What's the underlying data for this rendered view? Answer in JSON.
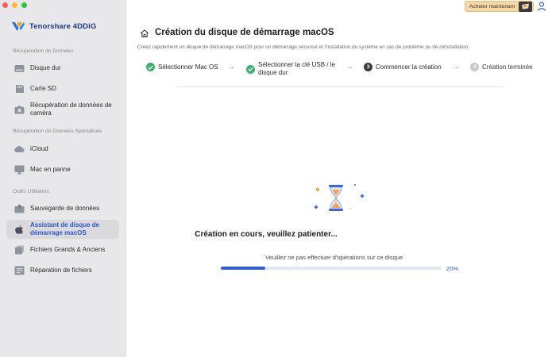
{
  "app": {
    "name": "Tenorshare 4DDiG"
  },
  "colors": {
    "accent": "#2f5bd8",
    "success": "#3ab26d",
    "sidebar_bg": "#e8e8ea",
    "buy_button": "#f6d9a6"
  },
  "header": {
    "buy_label": "Acheter maintenant",
    "buy_icon": "cart-icon",
    "user_icon": "user-icon"
  },
  "sidebar": {
    "sections": [
      {
        "title": "Récupération de Données",
        "items": [
          {
            "label": "Disque dur",
            "icon": "hard-drive-icon"
          },
          {
            "label": "Carte SD",
            "icon": "sd-card-icon"
          },
          {
            "label": "Récupération de données de caméra",
            "icon": "camera-icon"
          }
        ]
      },
      {
        "title": "Récupération de Données Spécialisée",
        "items": [
          {
            "label": "iCloud",
            "icon": "cloud-icon"
          },
          {
            "label": "Mac en panne",
            "icon": "mac-icon"
          }
        ]
      },
      {
        "title": "Outils Utilitaires",
        "items": [
          {
            "label": "Sauvegarde de données",
            "icon": "backup-icon"
          },
          {
            "label": "Assistant de disque de démarrage macOS",
            "icon": "apple-icon",
            "active": true
          },
          {
            "label": "Fichiers Grands & Anciens",
            "icon": "files-icon"
          },
          {
            "label": "Réparation de fichiers",
            "icon": "file-repair-icon"
          }
        ]
      }
    ]
  },
  "main": {
    "title": "Création du disque de démarrage macOS",
    "subtitle": "Créez rapidement un disque de démarrage macOS pour un démarrage sécurisé et l'installation du système en cas de problème ou de réinstallation.",
    "steps": [
      {
        "number": "1",
        "label": "Sélectionner Mac OS",
        "state": "done"
      },
      {
        "number": "2",
        "label": "Sélectionner la clé USB / le disque dur",
        "state": "done"
      },
      {
        "number": "3",
        "label": "Commencer la création",
        "state": "current"
      },
      {
        "number": "4",
        "label": "Création terminée",
        "state": "todo"
      }
    ],
    "status_title": "Création en cours, veuillez patienter...",
    "status_note": "Veuillez ne pas effectuer d'opérations sur ce disque",
    "progress": 0.2,
    "progress_label": "20%"
  }
}
